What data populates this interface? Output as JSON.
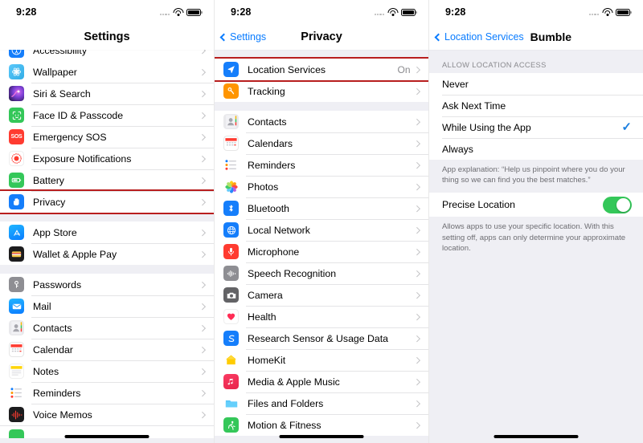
{
  "status_bar": {
    "time": "9:28",
    "wifi_icon": "wifi-icon",
    "battery_icon": "battery-icon",
    "signal_icon": "signal-dots-icon"
  },
  "panel1": {
    "title": "Settings",
    "groups": [
      {
        "rows": [
          {
            "label": "Accessibility",
            "icon": "accessibility-icon",
            "color": "#157efb",
            "partial": true
          },
          {
            "label": "Wallpaper",
            "icon": "wallpaper-icon",
            "color": "#5ac8fa"
          },
          {
            "label": "Siri & Search",
            "icon": "siri-icon",
            "color": "#2b1a4d"
          },
          {
            "label": "Face ID & Passcode",
            "icon": "face-id-icon",
            "color": "#34c759"
          },
          {
            "label": "Emergency SOS",
            "icon": "sos-icon",
            "color": "#ff3b30"
          },
          {
            "label": "Exposure Notifications",
            "icon": "exposure-notifications-icon",
            "color": "#ffffff"
          },
          {
            "label": "Battery",
            "icon": "battery-settings-icon",
            "color": "#34c759"
          },
          {
            "label": "Privacy",
            "icon": "privacy-hand-icon",
            "color": "#157efb",
            "highlighted": true
          }
        ]
      },
      {
        "rows": [
          {
            "label": "App Store",
            "icon": "app-store-icon",
            "color": "#157efb"
          },
          {
            "label": "Wallet & Apple Pay",
            "icon": "wallet-icon",
            "color": "#1c1c1e"
          }
        ]
      },
      {
        "rows": [
          {
            "label": "Passwords",
            "icon": "passwords-key-icon",
            "color": "#8e8e93"
          },
          {
            "label": "Mail",
            "icon": "mail-icon",
            "color": "#157efb"
          },
          {
            "label": "Contacts",
            "icon": "contacts-icon",
            "color": "#c7c7cc"
          },
          {
            "label": "Calendar",
            "icon": "calendar-icon",
            "color": "#ffffff"
          },
          {
            "label": "Notes",
            "icon": "notes-icon",
            "color": "#ffd60a"
          },
          {
            "label": "Reminders",
            "icon": "reminders-icon",
            "color": "#ffffff"
          },
          {
            "label": "Voice Memos",
            "icon": "voice-memos-icon",
            "color": "#1c1c1e"
          }
        ]
      }
    ]
  },
  "panel2": {
    "back_label": "Settings",
    "title": "Privacy",
    "groups": [
      {
        "rows": [
          {
            "label": "Location Services",
            "icon": "location-arrow-icon",
            "color": "#157efb",
            "value": "On",
            "highlighted": true
          },
          {
            "label": "Tracking",
            "icon": "tracking-icon",
            "color": "#ff9500"
          }
        ]
      },
      {
        "rows": [
          {
            "label": "Contacts",
            "icon": "contacts-icon",
            "color": "#c7c7cc"
          },
          {
            "label": "Calendars",
            "icon": "calendar-icon",
            "color": "#ffffff"
          },
          {
            "label": "Reminders",
            "icon": "reminders-icon",
            "color": "#ffffff"
          },
          {
            "label": "Photos",
            "icon": "photos-icon",
            "color": "#ffffff"
          },
          {
            "label": "Bluetooth",
            "icon": "bluetooth-icon",
            "color": "#157efb"
          },
          {
            "label": "Local Network",
            "icon": "local-network-icon",
            "color": "#157efb"
          },
          {
            "label": "Microphone",
            "icon": "microphone-icon",
            "color": "#ff3b30"
          },
          {
            "label": "Speech Recognition",
            "icon": "speech-recognition-icon",
            "color": "#8e8e93"
          },
          {
            "label": "Camera",
            "icon": "camera-icon",
            "color": "#636366"
          },
          {
            "label": "Health",
            "icon": "health-heart-icon",
            "color": "#ffffff"
          },
          {
            "label": "Research Sensor & Usage Data",
            "icon": "research-sensor-icon",
            "color": "#157efb"
          },
          {
            "label": "HomeKit",
            "icon": "homekit-icon",
            "color": "#ffcc00"
          },
          {
            "label": "Media & Apple Music",
            "icon": "media-music-icon",
            "color": "#fa2d48"
          },
          {
            "label": "Files and Folders",
            "icon": "files-folder-icon",
            "color": "#5ac8fa"
          },
          {
            "label": "Motion & Fitness",
            "icon": "motion-fitness-icon",
            "color": "#34c759"
          }
        ]
      }
    ]
  },
  "panel3": {
    "back_label": "Location Services",
    "title": "Bumble",
    "section_header": "ALLOW LOCATION ACCESS",
    "options": [
      {
        "label": "Never",
        "selected": false
      },
      {
        "label": "Ask Next Time",
        "selected": false
      },
      {
        "label": "While Using the App",
        "selected": true
      },
      {
        "label": "Always",
        "selected": false
      }
    ],
    "app_explanation": "App explanation: “Help us pinpoint where you do your thing so we can find you the best matches.”",
    "precise_location": {
      "label": "Precise Location",
      "enabled": true
    },
    "precise_footnote": "Allows apps to use your specific location. With this setting off, apps can only determine your approximate location."
  },
  "colors": {
    "accent_blue": "#157efb",
    "highlight_red": "#b81e1e",
    "toggle_green": "#34c759",
    "check_blue": "#1b7fe0"
  }
}
